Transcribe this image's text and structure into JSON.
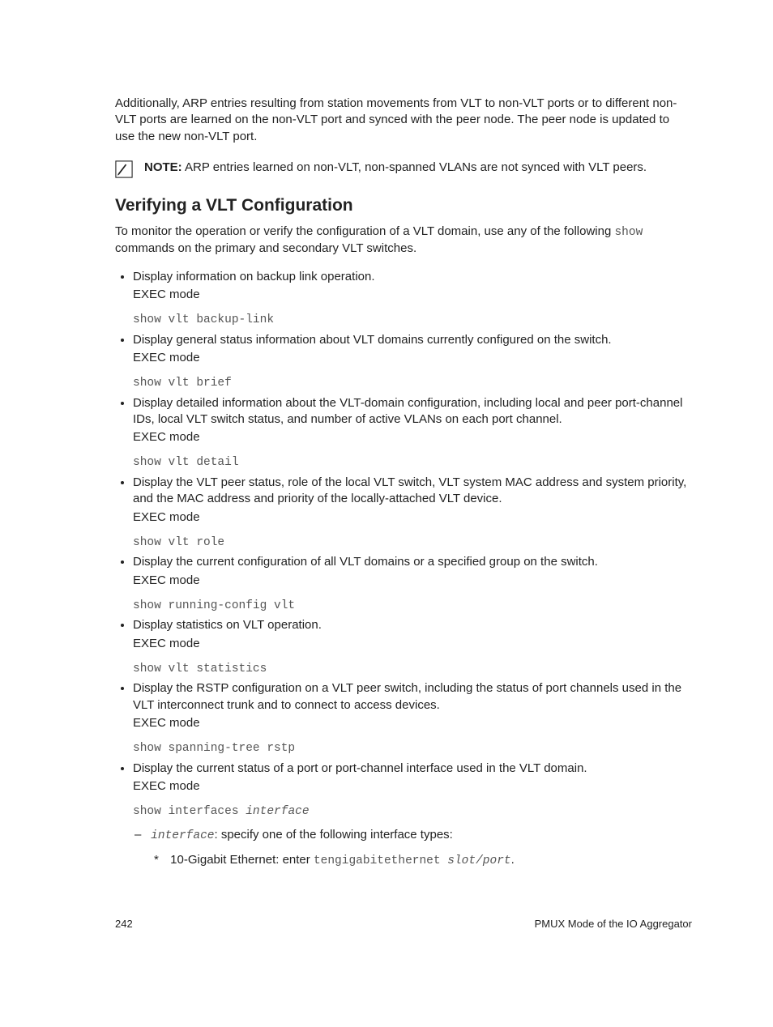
{
  "intro": "Additionally, ARP entries resulting from station movements from VLT to non-VLT ports or to different non-VLT ports are learned on the non-VLT port and synced with the peer node. The peer node is updated to use the new non-VLT port.",
  "note": {
    "label": "NOTE:",
    "text": " ARP entries learned on non-VLT, non-spanned VLANs are not synced with VLT peers."
  },
  "heading": "Verifying a VLT Configuration",
  "lead_pre": "To monitor the operation or verify the configuration of a VLT domain, use any of the following ",
  "lead_code": "show",
  "lead_post": " commands on the primary and secondary VLT switches.",
  "items": [
    {
      "desc": "Display information on backup link operation.",
      "mode": "EXEC mode",
      "cmd": "show vlt backup-link"
    },
    {
      "desc": "Display general status information about VLT domains currently configured on the switch.",
      "mode": "EXEC mode",
      "cmd": "show vlt brief"
    },
    {
      "desc": "Display detailed information about the VLT-domain configuration, including local and peer port-channel IDs, local VLT switch status, and number of active VLANs on each port channel.",
      "mode": "EXEC mode",
      "cmd": "show vlt detail"
    },
    {
      "desc": "Display the VLT peer status, role of the local VLT switch, VLT system MAC address and system priority, and the MAC address and priority of the locally-attached VLT device.",
      "mode": "EXEC mode",
      "cmd": "show vlt role"
    },
    {
      "desc": "Display the current configuration of all VLT domains or a specified group on the switch.",
      "mode": "EXEC mode",
      "cmd": "show running-config vlt"
    },
    {
      "desc": "Display statistics on VLT operation.",
      "mode": "EXEC mode",
      "cmd": "show vlt statistics"
    },
    {
      "desc": "Display the RSTP configuration on a VLT peer switch, including the status of port channels used in the VLT interconnect trunk and to connect to access devices.",
      "mode": "EXEC mode",
      "cmd": "show spanning-tree rstp"
    },
    {
      "desc": "Display the current status of a port or port-channel interface used in the VLT domain.",
      "mode": "EXEC mode",
      "cmd_pre": "show interfaces ",
      "cmd_ital": "interface"
    }
  ],
  "sub": {
    "param": "interface",
    "param_text": ": specify one of the following interface types:",
    "star_pre": "10-Gigabit Ethernet: enter ",
    "star_code": "tengigabitethernet ",
    "star_ital": "slot/port",
    "star_post": "."
  },
  "footer": {
    "page": "242",
    "title": "PMUX Mode of the IO Aggregator"
  }
}
